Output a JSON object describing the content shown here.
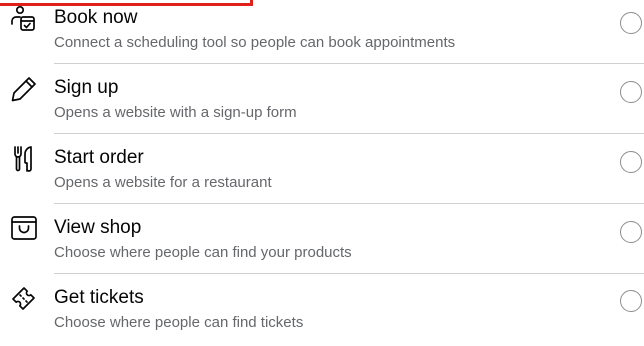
{
  "options": [
    {
      "title": "Book now",
      "description": "Connect a scheduling tool so people can book appointments",
      "icon": "calendar-person-icon"
    },
    {
      "title": "Sign up",
      "description": "Opens a website with a sign-up form",
      "icon": "pencil-icon"
    },
    {
      "title": "Start order",
      "description": "Opens a website for a restaurant",
      "icon": "fork-knife-icon"
    },
    {
      "title": "View shop",
      "description": "Choose where people can find your products",
      "icon": "shopping-bag-icon"
    },
    {
      "title": "Get tickets",
      "description": "Choose where people can find tickets",
      "icon": "ticket-icon"
    }
  ],
  "colors": {
    "title": "#050505",
    "description": "#65676b",
    "divider": "#ced0d4",
    "radio_border": "#8a8d91",
    "highlight": "#e0211b"
  }
}
